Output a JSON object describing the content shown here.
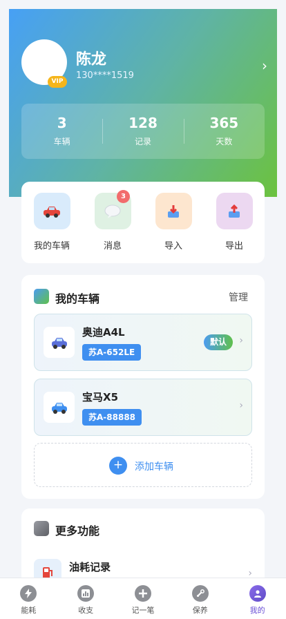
{
  "profile": {
    "name": "陈龙",
    "phone": "130****1519",
    "vip_label": "VIP",
    "arrow_icon": "chevron-right-icon"
  },
  "stats": [
    {
      "value": "3",
      "label": "车辆"
    },
    {
      "value": "128",
      "label": "记录"
    },
    {
      "value": "365",
      "label": "天数"
    }
  ],
  "quick_actions": [
    {
      "label": "我的车辆",
      "icon": "car-icon",
      "bg": "#d9ebfb"
    },
    {
      "label": "消息",
      "icon": "chat-bubble-icon",
      "bg": "#dff1e3",
      "badge": "3"
    },
    {
      "label": "导入",
      "icon": "import-icon",
      "bg": "#fde6cf"
    },
    {
      "label": "导出",
      "icon": "export-icon",
      "bg": "#ecd8f1"
    }
  ],
  "vehicles_section": {
    "title": "我的车辆",
    "manage_label": "管理",
    "items": [
      {
        "name": "奥迪A4L",
        "plate": "苏A-652LE",
        "default_label": "默认"
      },
      {
        "name": "宝马X5",
        "plate": "苏A-88888"
      }
    ],
    "add_icon": "+",
    "add_label": "添加车辆"
  },
  "more_section": {
    "title": "更多功能",
    "items": [
      {
        "label": "油耗记录",
        "icon": "fuel-pump-icon"
      }
    ]
  },
  "tabbar": [
    {
      "label": "能耗",
      "icon": "lightning-icon"
    },
    {
      "label": "收支",
      "icon": "bar-chart-icon"
    },
    {
      "label": "记一笔",
      "icon": "plus-icon"
    },
    {
      "label": "保养",
      "icon": "wrench-icon"
    },
    {
      "label": "我的",
      "icon": "user-icon",
      "active": true
    }
  ],
  "colors": {
    "accent_blue": "#3f8ff0",
    "header_gradient_start": "#47a0f5",
    "header_gradient_end": "#6cc23f",
    "badge_red": "#f26c6c",
    "vip_gold": "#f5b51b",
    "active_tab": "#6a4fd6"
  }
}
